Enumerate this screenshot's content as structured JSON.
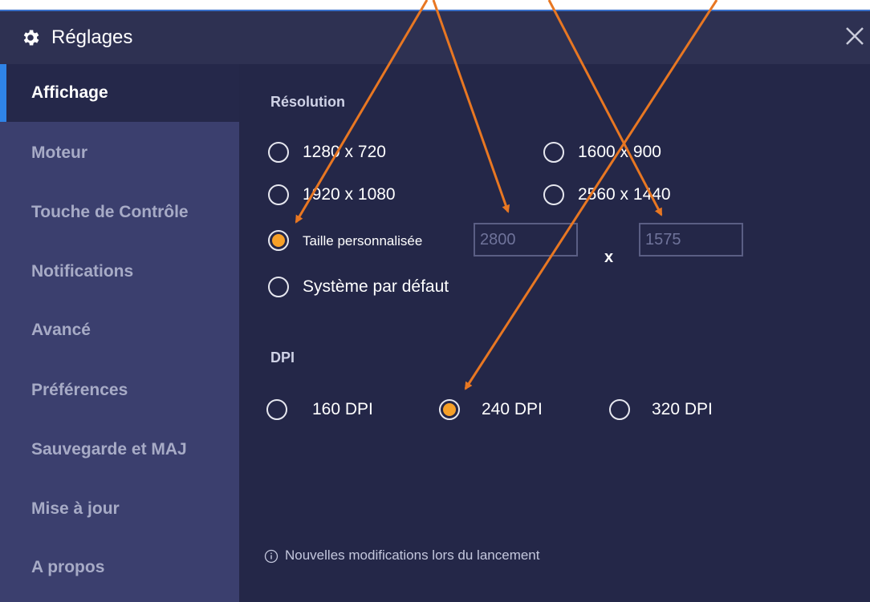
{
  "window": {
    "title": "Réglages",
    "icons": {
      "title": "gear-icon",
      "close": "close-icon",
      "info": "info-icon"
    },
    "colors": {
      "accent": "#2f84e8",
      "selected_radio": "#f6a028",
      "annotation_arrow": "#e87722"
    }
  },
  "sidebar": {
    "items": [
      {
        "label": "Affichage",
        "active": true
      },
      {
        "label": "Moteur"
      },
      {
        "label": "Touche de Contrôle"
      },
      {
        "label": "Notifications"
      },
      {
        "label": "Avancé"
      },
      {
        "label": "Préférences"
      },
      {
        "label": "Sauvegarde et MAJ"
      },
      {
        "label": "Mise à jour"
      },
      {
        "label": "A propos"
      }
    ]
  },
  "resolution": {
    "title": "Résolution",
    "options": [
      {
        "label": "1280 x 720",
        "selected": false
      },
      {
        "label": "1600 x 900",
        "selected": false
      },
      {
        "label": "1920 x 1080",
        "selected": false
      },
      {
        "label": "2560 x 1440",
        "selected": false
      },
      {
        "label": "Taille personnalisée",
        "selected": true
      },
      {
        "label": "Système par défaut",
        "selected": false
      }
    ],
    "custom_width": "2800",
    "custom_height": "1575",
    "separator": "x"
  },
  "dpi": {
    "title": "DPI",
    "options": [
      {
        "label": "160 DPI",
        "selected": false
      },
      {
        "label": "240 DPI",
        "selected": true
      },
      {
        "label": "320 DPI",
        "selected": false
      }
    ]
  },
  "footer": {
    "note": "Nouvelles modifications lors du lancement"
  }
}
